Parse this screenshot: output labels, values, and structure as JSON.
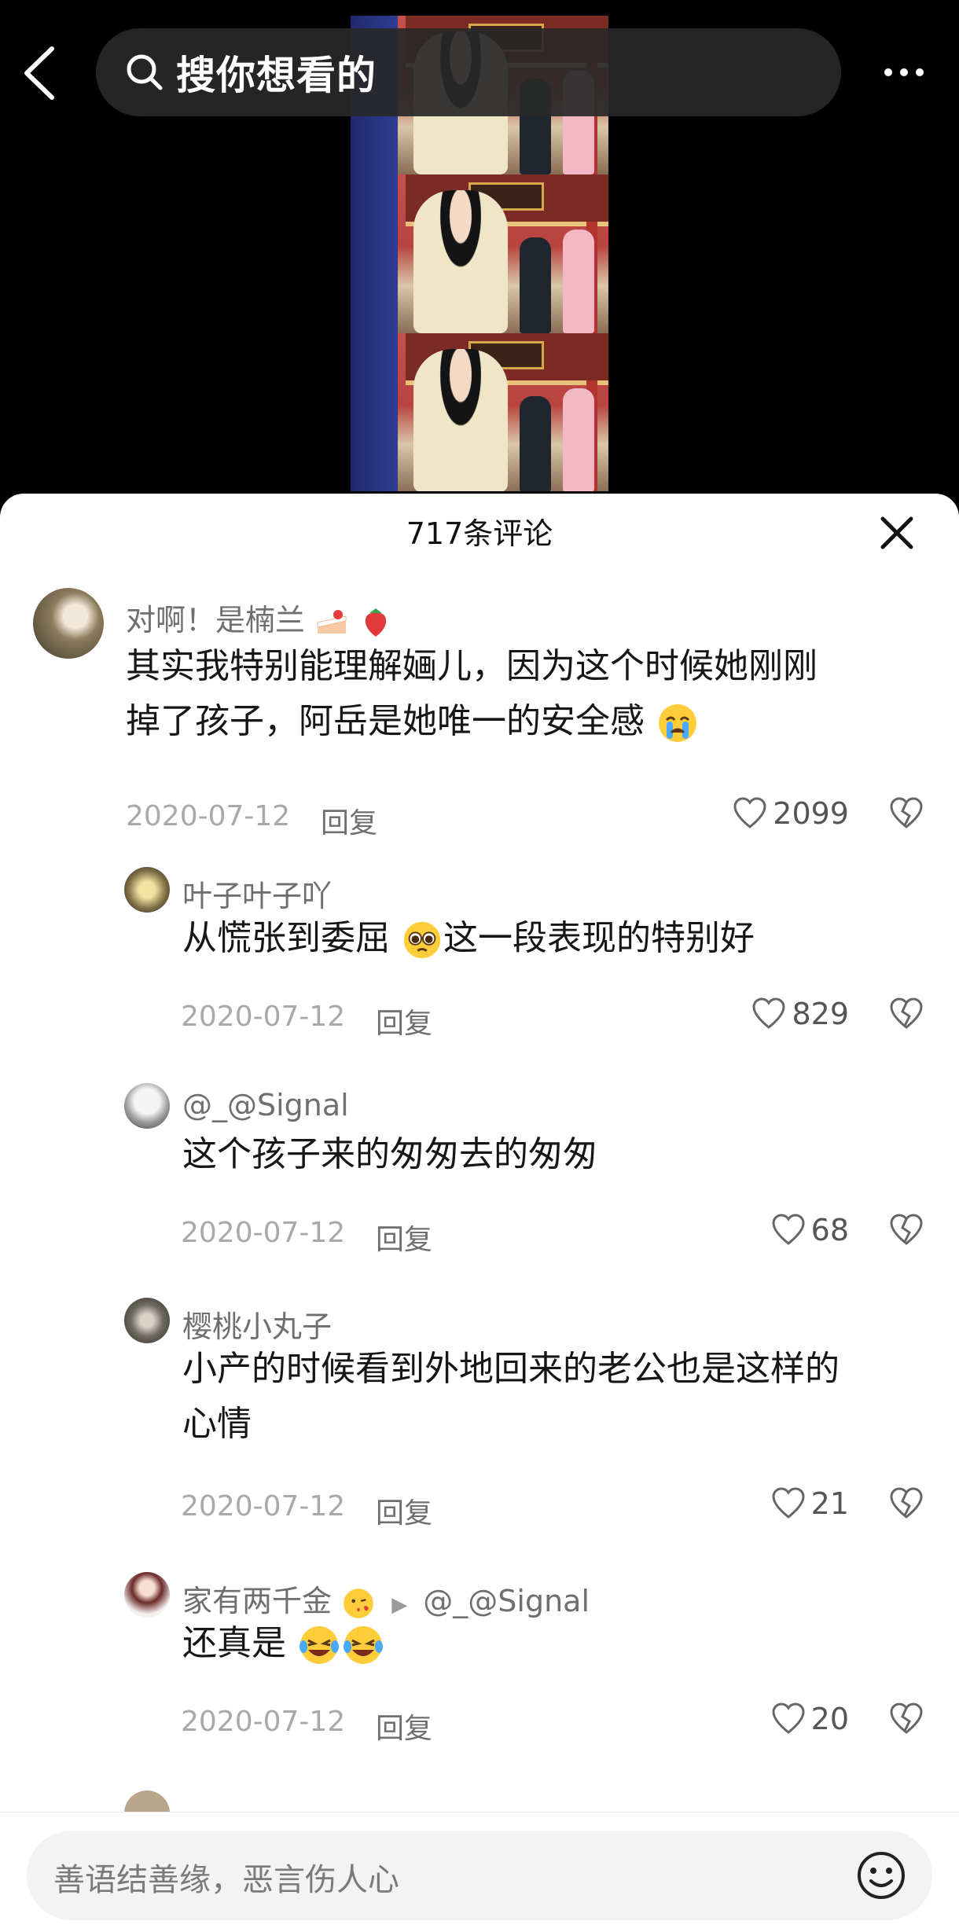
{
  "search": {
    "query": "搜你想看的"
  },
  "icons": {
    "back": "back-chevron-icon",
    "search": "search-icon",
    "more": "more-dots-icon",
    "close": "close-icon",
    "like": "heart-icon",
    "dislike": "broken-heart-icon",
    "emoji": "smiley-icon"
  },
  "comments_header": {
    "count": "717条评论"
  },
  "comments": [
    {
      "user": "对啊！是楠兰",
      "text_line1": "其实我特别能理解婳儿，因为这个时候她刚刚",
      "text_line2": "掉了孩子，阿岳是她唯一的安全感",
      "date": "2020-07-12",
      "reply": "回复",
      "likes": "2099"
    },
    {
      "user": "叶子叶子吖",
      "text_line1": "从慌张到委屈",
      "text_line1b": "这一段表现的特别好",
      "date": "2020-07-12",
      "reply": "回复",
      "likes": "829"
    },
    {
      "user": "@_@Signal",
      "text_line1": "这个孩子来的匆匆去的匆匆",
      "date": "2020-07-12",
      "reply": "回复",
      "likes": "68"
    },
    {
      "user": "樱桃小丸子",
      "text_line1": "小产的时候看到外地回来的老公也是这样的",
      "text_line2": "心情",
      "date": "2020-07-12",
      "reply": "回复",
      "likes": "21"
    },
    {
      "user": "家有两千金",
      "reply_to": "@_@Signal",
      "text_line1": "还真是",
      "date": "2020-07-12",
      "reply": "回复",
      "likes": "20"
    }
  ],
  "footer": {
    "placeholder": "善语结善缘，恶言伤人心"
  },
  "colors": {
    "background_top": "#000000",
    "sheet": "#ffffff",
    "muted": "#a9a9a9",
    "name": "#6f6f6f"
  }
}
